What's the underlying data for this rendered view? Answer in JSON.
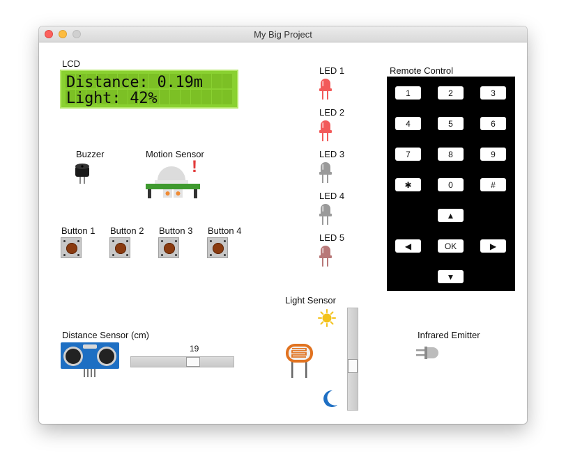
{
  "window": {
    "title": "My Big Project"
  },
  "lcd": {
    "label": "LCD",
    "line1": "Distance: 0.19m",
    "line2": "Light: 42%"
  },
  "buzzer": {
    "label": "Buzzer"
  },
  "motion_sensor": {
    "label": "Motion Sensor",
    "alert": "!"
  },
  "buttons": [
    {
      "label": "Button 1"
    },
    {
      "label": "Button 2"
    },
    {
      "label": "Button 3"
    },
    {
      "label": "Button 4"
    }
  ],
  "leds": [
    {
      "label": "LED 1",
      "state": "on",
      "color": "#f25a5a"
    },
    {
      "label": "LED 2",
      "state": "on",
      "color": "#f25a5a"
    },
    {
      "label": "LED 3",
      "state": "off",
      "color": "#9a9a9a"
    },
    {
      "label": "LED 4",
      "state": "off",
      "color": "#9a9a9a"
    },
    {
      "label": "LED 5",
      "state": "dim",
      "color": "#b87878"
    }
  ],
  "remote": {
    "label": "Remote Control",
    "keys": [
      "1",
      "2",
      "3",
      "4",
      "5",
      "6",
      "7",
      "8",
      "9",
      "✱",
      "0",
      "#",
      "▲",
      "◀",
      "OK",
      "▶",
      "▼"
    ]
  },
  "distance_sensor": {
    "label": "Distance Sensor (cm)",
    "value": "19",
    "fraction": 0.62
  },
  "light_sensor": {
    "label": "Light Sensor",
    "fraction": 0.42
  },
  "infrared_emitter": {
    "label": "Infrared Emitter"
  },
  "colors": {
    "lcd_bg": "#8ad131",
    "led_on": "#f25a5a",
    "led_off": "#9a9a9a",
    "button_cap": "#8a3b10",
    "sensor_blue": "#1e6fc3"
  }
}
